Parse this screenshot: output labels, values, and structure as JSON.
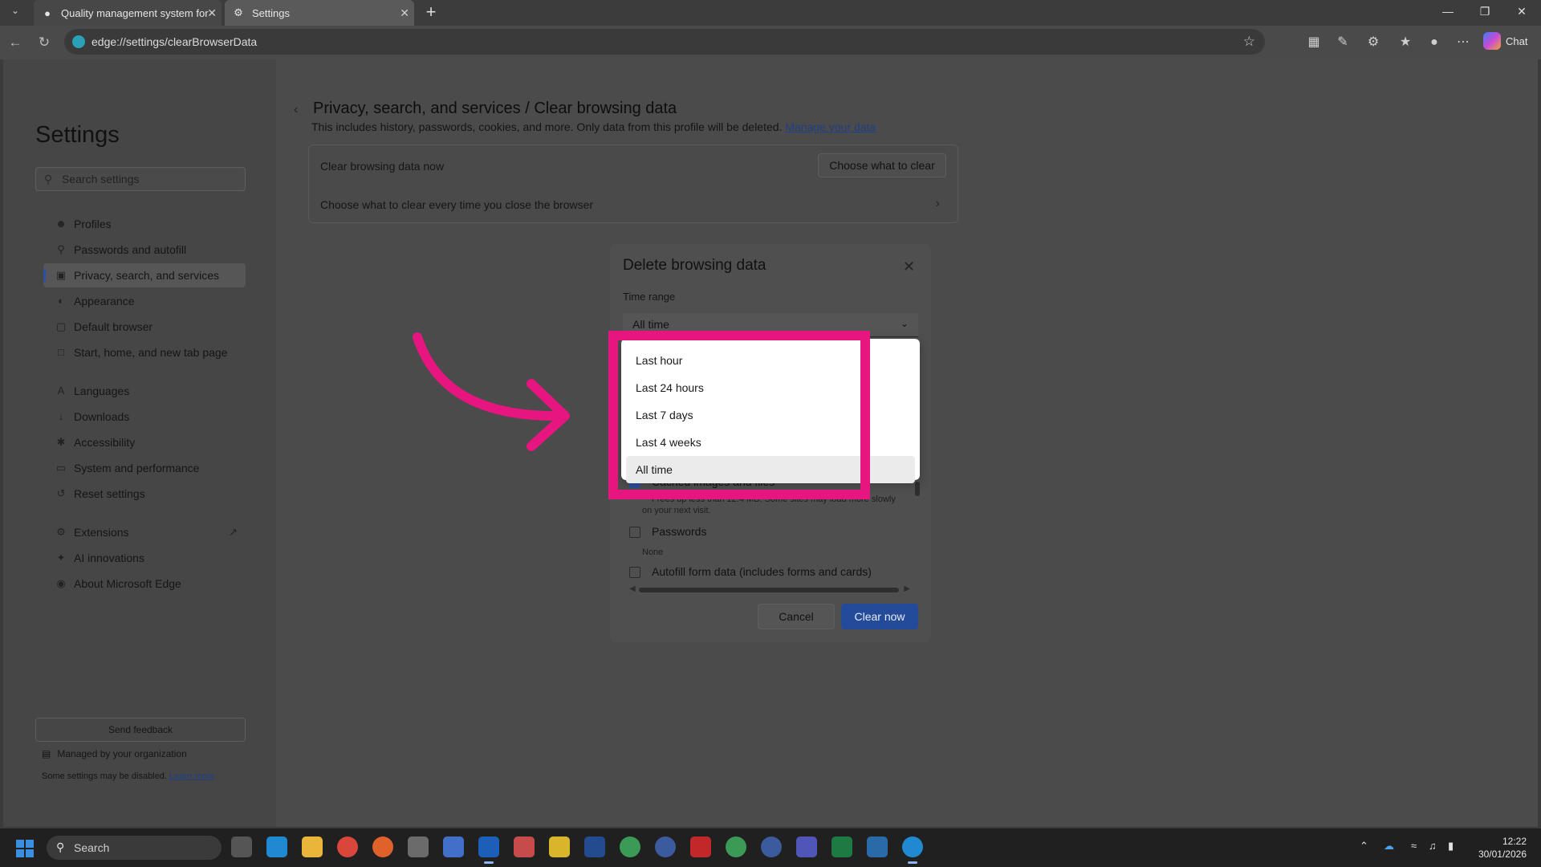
{
  "browser": {
    "tabs": [
      {
        "title": "Quality management system for",
        "icon": "app-icon"
      },
      {
        "title": "Settings",
        "icon": "gear-icon"
      }
    ],
    "url": "edge://settings/clearBrowserData",
    "chat_label": "Chat"
  },
  "sidebar": {
    "title": "Settings",
    "search_placeholder": "Search settings",
    "items": [
      {
        "label": "Profiles",
        "icon": "profile-icon"
      },
      {
        "label": "Passwords and autofill",
        "icon": "key-icon"
      },
      {
        "label": "Privacy, search, and services",
        "icon": "lock-icon",
        "active": true
      },
      {
        "label": "Appearance",
        "icon": "palette-icon"
      },
      {
        "label": "Default browser",
        "icon": "browser-icon"
      },
      {
        "label": "Start, home, and new tab page",
        "icon": "home-icon"
      },
      {
        "label": "Languages",
        "icon": "language-icon"
      },
      {
        "label": "Downloads",
        "icon": "download-icon"
      },
      {
        "label": "Accessibility",
        "icon": "accessibility-icon"
      },
      {
        "label": "System and performance",
        "icon": "laptop-icon"
      },
      {
        "label": "Reset settings",
        "icon": "reset-icon"
      },
      {
        "label": "Extensions",
        "icon": "extensions-icon"
      },
      {
        "label": "AI innovations",
        "icon": "ai-icon"
      },
      {
        "label": "About Microsoft Edge",
        "icon": "edge-icon"
      }
    ],
    "feedback": "Send feedback",
    "managed": "Managed by your organization",
    "managed_note": "Some settings may be disabled.",
    "learn_more": "Learn more"
  },
  "main": {
    "breadcrumb_parent": "Privacy, search, and services",
    "breadcrumb_sep": "/",
    "breadcrumb_current": "Clear browsing data",
    "description": "This includes history, passwords, cookies, and more. Only data from this profile will be deleted.",
    "manage_link": "Manage your data",
    "clear_now_label": "Clear browsing data now",
    "choose_button": "Choose what to clear",
    "clear_on_close": "Choose what to clear every time you close the browser"
  },
  "dialog": {
    "title": "Delete browsing data",
    "time_range_label": "Time range",
    "selected_range": "All time",
    "options": [
      "Last hour",
      "Last 24 hours",
      "Last 7 days",
      "Last 4 weeks",
      "All time"
    ],
    "cached_label": "Cached images and files",
    "cached_note_a": "Frees up less than 12.4 MB. Some sites may load more slowly",
    "cached_note_b": "on your next visit.",
    "passwords_label": "Passwords",
    "passwords_note": "None",
    "autofill_label": "Autofill form data (includes forms and cards)",
    "cancel": "Cancel",
    "clear_now": "Clear now"
  },
  "taskbar": {
    "search_placeholder": "Search",
    "time": "12:22",
    "date": "30/01/2026"
  },
  "colors": {
    "highlight": "#e6157f",
    "accent": "#244b9a"
  }
}
